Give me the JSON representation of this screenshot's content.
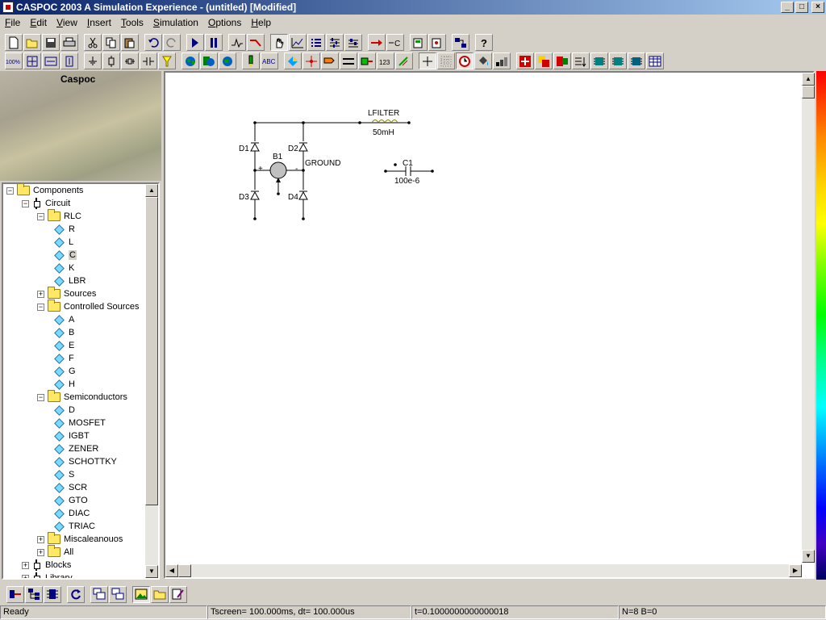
{
  "window": {
    "title": "CASPOC 2003 A Simulation Experience - (untitled) [Modified]",
    "buttons": {
      "minimize": "_",
      "maximize": "□",
      "close": "×"
    }
  },
  "menu": [
    {
      "label": "File",
      "accel": "F",
      "rest": "ile"
    },
    {
      "label": "Edit",
      "accel": "E",
      "rest": "dit"
    },
    {
      "label": "View",
      "accel": "V",
      "rest": "iew"
    },
    {
      "label": "Insert",
      "accel": "I",
      "rest": "nsert"
    },
    {
      "label": "Tools",
      "accel": "T",
      "rest": "ools"
    },
    {
      "label": "Simulation",
      "accel": "S",
      "rest": "imulation"
    },
    {
      "label": "Options",
      "accel": "O",
      "rest": "ptions"
    },
    {
      "label": "Help",
      "accel": "H",
      "rest": "elp"
    }
  ],
  "toolbar_icons": {
    "new": "new-file-icon",
    "open": "open-folder-icon",
    "save": "save-icon",
    "print": "print-icon",
    "zoom_label": "100%",
    "text_tool": "ABC"
  },
  "sidebar": {
    "banner_title": "Caspoc",
    "tree": [
      {
        "label": "Components",
        "type": "folder",
        "exp": "−"
      },
      {
        "label": "Circuit",
        "type": "circuit",
        "exp": "−"
      },
      {
        "label": "RLC",
        "type": "folder",
        "exp": "−"
      },
      {
        "label": "R",
        "type": "item"
      },
      {
        "label": "L",
        "type": "item"
      },
      {
        "label": "C",
        "type": "item",
        "selected": true
      },
      {
        "label": "K",
        "type": "item"
      },
      {
        "label": "LBR",
        "type": "item"
      },
      {
        "label": "Sources",
        "type": "folder",
        "exp": "+"
      },
      {
        "label": "Controlled Sources",
        "type": "folder",
        "exp": "−"
      },
      {
        "label": "A",
        "type": "item"
      },
      {
        "label": "B",
        "type": "item"
      },
      {
        "label": "E",
        "type": "item"
      },
      {
        "label": "F",
        "type": "item"
      },
      {
        "label": "G",
        "type": "item"
      },
      {
        "label": "H",
        "type": "item"
      },
      {
        "label": "Semiconductors",
        "type": "folder",
        "exp": "−"
      },
      {
        "label": "D",
        "type": "item"
      },
      {
        "label": "MOSFET",
        "type": "item"
      },
      {
        "label": "IGBT",
        "type": "item"
      },
      {
        "label": "ZENER",
        "type": "item"
      },
      {
        "label": "SCHOTTKY",
        "type": "item"
      },
      {
        "label": "S",
        "type": "item"
      },
      {
        "label": "SCR",
        "type": "item"
      },
      {
        "label": "GTO",
        "type": "item"
      },
      {
        "label": "DIAC",
        "type": "item"
      },
      {
        "label": "TRIAC",
        "type": "item"
      },
      {
        "label": "Miscaleanouos",
        "type": "folder",
        "exp": "+"
      },
      {
        "label": "All",
        "type": "folder",
        "exp": "+"
      },
      {
        "label": "Blocks",
        "type": "circuit",
        "exp": "+"
      },
      {
        "label": "Library",
        "type": "circuit",
        "exp": "+"
      }
    ]
  },
  "schematic": {
    "inductor": {
      "name": "LFILTER",
      "value": "50mH"
    },
    "capacitor": {
      "name": "C1",
      "value": "100e-6"
    },
    "source": {
      "name": "B1",
      "plus": "+",
      "minus": "-",
      "ground": "GROUND"
    },
    "diodes": {
      "d1": "D1",
      "d2": "D2",
      "d3": "D3",
      "d4": "D4"
    }
  },
  "status": {
    "ready": "Ready",
    "tscreen": "Tscreen= 100.000ms, dt= 100.000us",
    "time": "t=0.1000000000000018",
    "counts": "N=8 B=0"
  }
}
